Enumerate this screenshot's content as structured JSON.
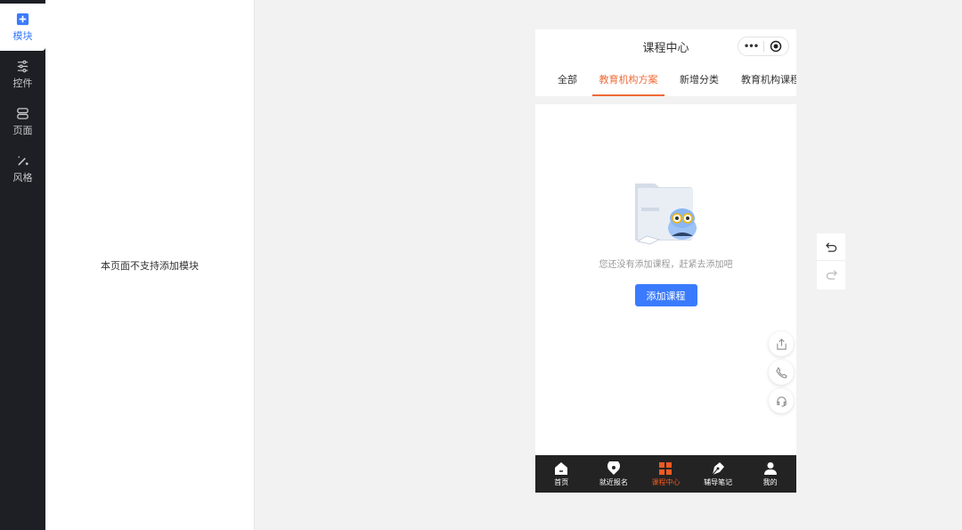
{
  "sidebar": {
    "items": [
      {
        "label": "模块",
        "icon": "plus-square-icon",
        "active": true
      },
      {
        "label": "控件",
        "icon": "sliders-icon"
      },
      {
        "label": "页面",
        "icon": "pages-icon"
      },
      {
        "label": "风格",
        "icon": "magic-wand-icon"
      }
    ]
  },
  "panel": {
    "message": "本页面不支持添加模块"
  },
  "phone": {
    "title": "课程中心",
    "tabs": [
      "全部",
      "教育机构方案",
      "新增分类",
      "教育机构课程"
    ],
    "active_tab": 1,
    "empty": {
      "message": "您还没有添加课程，赶紧去添加吧",
      "button": "添加课程"
    },
    "tabbar": [
      {
        "label": "首页",
        "icon": "home-icon"
      },
      {
        "label": "就近报名",
        "icon": "location-icon"
      },
      {
        "label": "课程中心",
        "icon": "grid-icon",
        "active": true
      },
      {
        "label": "辅导笔记",
        "icon": "pen-icon"
      },
      {
        "label": "我的",
        "icon": "user-icon"
      }
    ]
  },
  "colors": {
    "accent": "#f06a35",
    "primary": "#3a7bfd",
    "sidebar": "#1e1f24"
  }
}
